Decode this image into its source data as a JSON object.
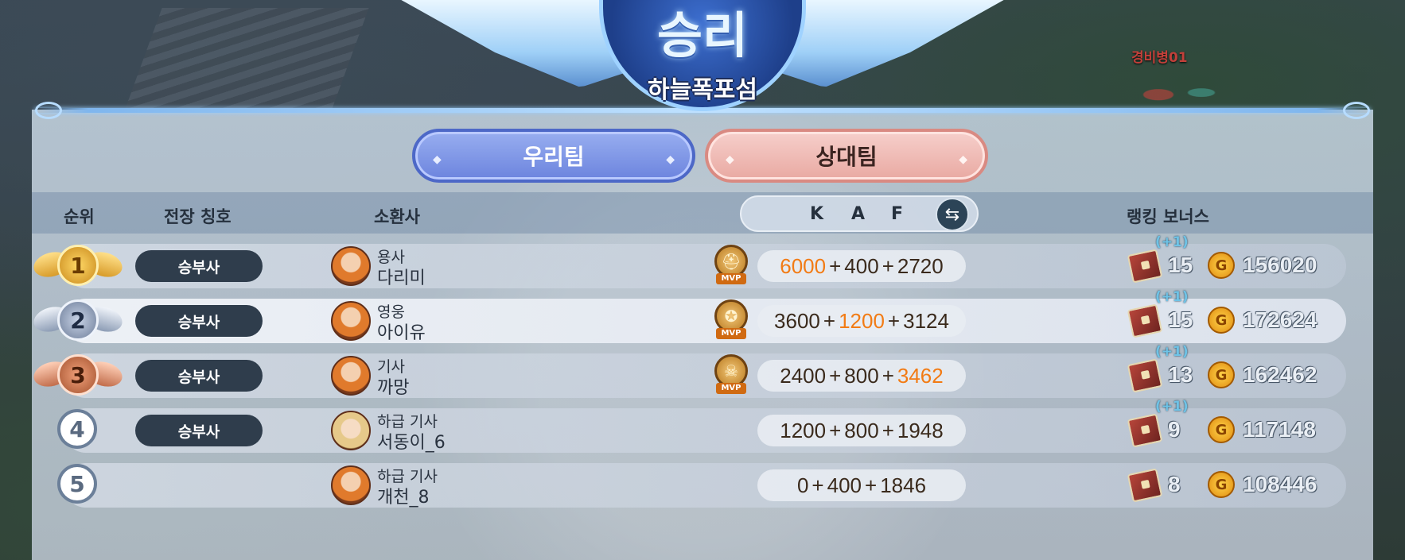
{
  "result": {
    "title": "승리",
    "map_name": "하늘폭포섬"
  },
  "world": {
    "enemy_name_tag": "경비병01"
  },
  "tabs": [
    {
      "label": "우리팀",
      "selected": true
    },
    {
      "label": "상대팀",
      "selected": false
    }
  ],
  "header": {
    "rank": "순위",
    "title": "전장 칭호",
    "summoner": "소환사",
    "kaf": [
      "K",
      "A",
      "F"
    ],
    "bonus": "랭킹 보너스"
  },
  "colors": {
    "highlight": "#f27b14",
    "badge": "#2f3d4c",
    "ours_tab": "#6c84de",
    "enemy_tab": "#e9a9a2"
  },
  "mvp_label": "MVP",
  "rows": [
    {
      "rank": "1",
      "title": "승부사",
      "summoner_rank": "용사",
      "name": "다리미",
      "mvp": true,
      "mvp_icon": "helmet-icon",
      "k": "6000",
      "a": "400",
      "f": "2720",
      "hl": "k",
      "bonus_plus": "(+1)",
      "bonus": "15",
      "gold": "156020"
    },
    {
      "rank": "2",
      "title": "승부사",
      "summoner_rank": "영웅",
      "name": "아이유",
      "mvp": true,
      "mvp_icon": "shield-star-icon",
      "k": "3600",
      "a": "1200",
      "f": "3124",
      "hl": "a",
      "bonus_plus": "(+1)",
      "bonus": "15",
      "gold": "172624"
    },
    {
      "rank": "3",
      "title": "승부사",
      "summoner_rank": "기사",
      "name": "까망",
      "mvp": true,
      "mvp_icon": "skull-icon",
      "k": "2400",
      "a": "800",
      "f": "3462",
      "hl": "f",
      "bonus_plus": "(+1)",
      "bonus": "13",
      "gold": "162462"
    },
    {
      "rank": "4",
      "title": "승부사",
      "summoner_rank": "하급 기사",
      "name": "서동이_6",
      "mvp": false,
      "k": "1200",
      "a": "800",
      "f": "1948",
      "hl": "",
      "bonus_plus": "(+1)",
      "bonus": "9",
      "gold": "117148"
    },
    {
      "rank": "5",
      "title": "",
      "summoner_rank": "하급 기사",
      "name": "개천_8",
      "mvp": false,
      "k": "0",
      "a": "400",
      "f": "1846",
      "hl": "",
      "bonus_plus": "",
      "bonus": "8",
      "gold": "108446"
    }
  ]
}
